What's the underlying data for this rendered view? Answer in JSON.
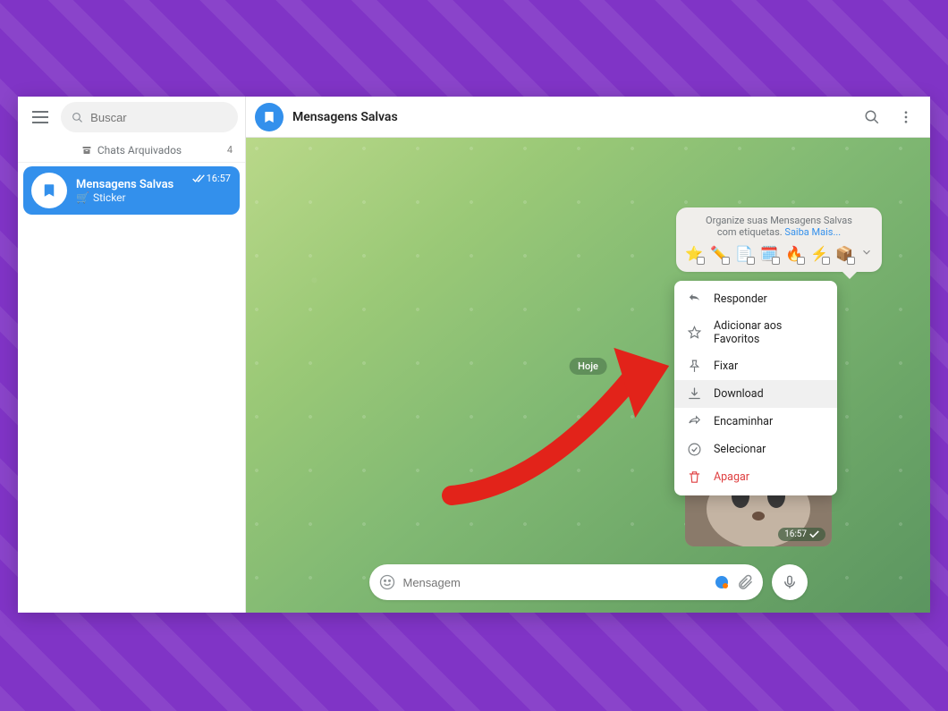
{
  "sidebar": {
    "search_placeholder": "Buscar",
    "archived_label": "Chats Arquivados",
    "archived_count": "4",
    "chat": {
      "title": "Mensagens Salvas",
      "subtitle_prefix": "🛒",
      "subtitle": "Sticker",
      "time": "16:57"
    }
  },
  "header": {
    "title": "Mensagens Salvas"
  },
  "hint": {
    "line1": "Organize suas Mensagens Salvas",
    "line2_prefix": "com etiquetas.",
    "link": "Saiba Mais...",
    "tags": [
      "⭐",
      "✏️",
      "📄",
      "🗓️",
      "🔥",
      "⚡",
      "📦"
    ]
  },
  "date_label": "Hoje",
  "sticker_time": "16:57",
  "context_menu": [
    {
      "icon": "reply",
      "label": "Responder",
      "danger": false
    },
    {
      "icon": "star",
      "label": "Adicionar aos Favoritos",
      "danger": false
    },
    {
      "icon": "pin",
      "label": "Fixar",
      "danger": false
    },
    {
      "icon": "download",
      "label": "Download",
      "danger": false,
      "highlighted": true
    },
    {
      "icon": "forward",
      "label": "Encaminhar",
      "danger": false
    },
    {
      "icon": "select",
      "label": "Selecionar",
      "danger": false
    },
    {
      "icon": "trash",
      "label": "Apagar",
      "danger": true
    }
  ],
  "composer": {
    "placeholder": "Mensagem"
  },
  "colors": {
    "accent": "#3390ec",
    "danger": "#df3f40",
    "page_bg": "#8034c6"
  }
}
